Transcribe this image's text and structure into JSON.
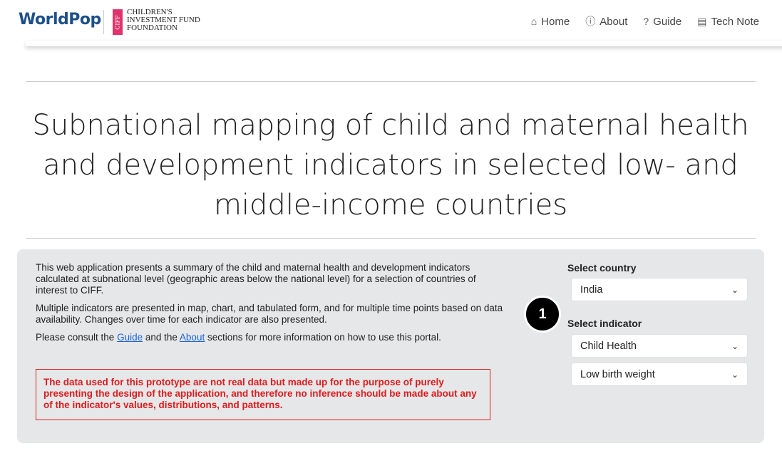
{
  "header": {
    "brand": "WorldPop",
    "ciff_badge": "CIFF",
    "ciff_lines": [
      "CHILDREN'S",
      "INVESTMENT FUND",
      "FOUNDATION"
    ],
    "nav": [
      {
        "icon": "home-icon",
        "glyph": "⌂",
        "label": "Home"
      },
      {
        "icon": "info-icon",
        "glyph": "ⓘ",
        "label": "About"
      },
      {
        "icon": "help-icon",
        "glyph": "?",
        "label": "Guide"
      },
      {
        "icon": "document-icon",
        "glyph": "▤",
        "label": "Tech Note"
      }
    ]
  },
  "main": {
    "title": "Subnational mapping of child and maternal health and development indicators in selected low- and middle-income countries"
  },
  "panel": {
    "para1": "This web application presents a summary of the child and maternal health and development indicators calculated at subnational level (geographic areas below the national level) for a selection of countries of interest to CIFF.",
    "para2": "Multiple indicators are presented in map, chart, and tabulated form, and for multiple time points based on data availability. Changes over time for each indicator are also presented.",
    "para3_prefix": "Please consult the ",
    "guide_link": "Guide",
    "para3_mid": " and the ",
    "about_link": "About",
    "para3_suffix": " sections for more information on how to use this portal.",
    "warning": "The data used for this prototype are not real data but made up for the purpose of purely presenting the design of the application, and therefore no inference should be made about any of the indicator's values, distributions, and patterns.",
    "country_label": "Select country",
    "country_value": "India",
    "indicator_label": "Select indicator",
    "indicator_category_value": "Child Health",
    "indicator_value": "Low birth weight",
    "step_badge": "1"
  },
  "colors": {
    "brand": "#1d4f8a",
    "ciff_pink": "#e0336b",
    "warning": "#e01b1b",
    "link": "#1b63d6",
    "panel_bg": "#e6e7e9"
  }
}
